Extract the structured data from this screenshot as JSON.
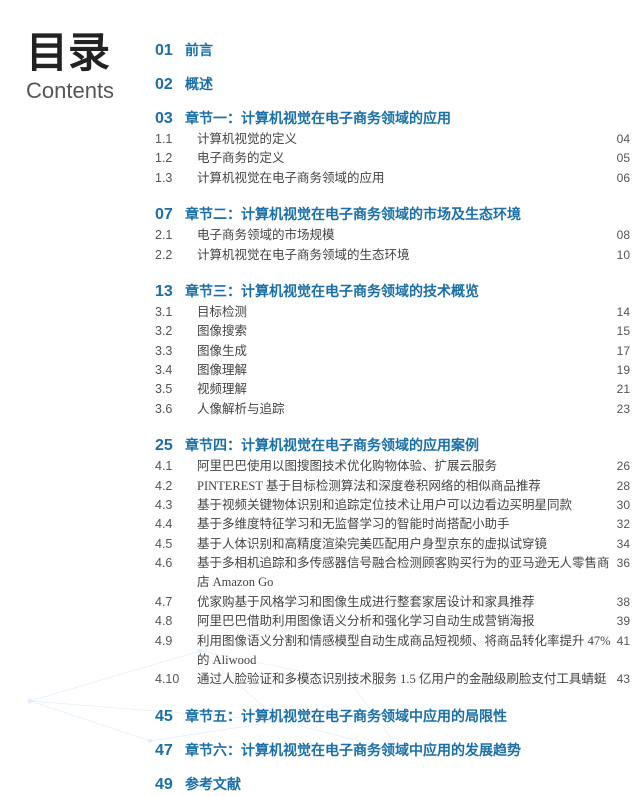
{
  "title": {
    "zh": "目录",
    "en": "Contents"
  },
  "sections": [
    {
      "num": "01",
      "label": "前言",
      "page": null,
      "items": []
    },
    {
      "num": "02",
      "label": "概述",
      "page": null,
      "items": []
    },
    {
      "num": "03",
      "label": "章节一：计算机视觉在电子商务领域的应用",
      "page": null,
      "items": [
        {
          "sub": "1.1",
          "label": "计算机视觉的定义",
          "page": "04"
        },
        {
          "sub": "1.2",
          "label": "电子商务的定义",
          "page": "05"
        },
        {
          "sub": "1.3",
          "label": "计算机视觉在电子商务领域的应用",
          "page": "06"
        }
      ]
    },
    {
      "num": "07",
      "label": "章节二：计算机视觉在电子商务领域的市场及生态环境",
      "page": null,
      "items": [
        {
          "sub": "2.1",
          "label": "电子商务领域的市场规模",
          "page": "08"
        },
        {
          "sub": "2.2",
          "label": "计算机视觉在电子商务领域的生态环境",
          "page": "10"
        }
      ]
    },
    {
      "num": "13",
      "label": "章节三：计算机视觉在电子商务领域的技术概览",
      "page": null,
      "items": [
        {
          "sub": "3.1",
          "label": "目标检测",
          "page": "14"
        },
        {
          "sub": "3.2",
          "label": "图像搜索",
          "page": "15"
        },
        {
          "sub": "3.3",
          "label": "图像生成",
          "page": "17"
        },
        {
          "sub": "3.4",
          "label": "图像理解",
          "page": "19"
        },
        {
          "sub": "3.5",
          "label": "视频理解",
          "page": "21"
        },
        {
          "sub": "3.6",
          "label": "人像解析与追踪",
          "page": "23"
        }
      ]
    },
    {
      "num": "25",
      "label": "章节四：计算机视觉在电子商务领域的应用案例",
      "page": null,
      "items": [
        {
          "sub": "4.1",
          "label": "阿里巴巴使用以图搜图技术优化购物体验、扩展云服务",
          "page": "26"
        },
        {
          "sub": "4.2",
          "label": "PINTEREST 基于目标检测算法和深度卷积网络的相似商品推荐",
          "page": "28"
        },
        {
          "sub": "4.3",
          "label": "基于视频关键物体识别和追踪定位技术让用户可以边看边买明星同款",
          "page": "30"
        },
        {
          "sub": "4.4",
          "label": "基于多维度特征学习和无监督学习的智能时尚搭配小助手",
          "page": "32"
        },
        {
          "sub": "4.5",
          "label": "基于人体识别和高精度渲染完美匹配用户身型京东的虚拟试穿镜",
          "page": "34"
        },
        {
          "sub": "4.6",
          "label": "基于多相机追踪和多传感器信号融合检测顾客购买行为的亚马逊无人零售商店 Amazon Go",
          "page": "36"
        },
        {
          "sub": "4.7",
          "label": "优家购基于风格学习和图像生成进行整套家居设计和家具推荐",
          "page": "38"
        },
        {
          "sub": "4.8",
          "label": "阿里巴巴借助利用图像语义分析和强化学习自动生成营销海报",
          "page": "39"
        },
        {
          "sub": "4.9",
          "label": "利用图像语义分割和情感模型自动生成商品短视频、将商品转化率提升 47% 的 Aliwood",
          "page": "41"
        },
        {
          "sub": "4.10",
          "label": "通过人脸验证和多模态识别技术服务 1.5 亿用户的金融级刷脸支付工具蜻蜓",
          "page": "43"
        }
      ]
    },
    {
      "num": "45",
      "label": "章节五：计算机视觉在电子商务领域中应用的局限性",
      "page": null,
      "items": []
    },
    {
      "num": "47",
      "label": "章节六：计算机视觉在电子商务领域中应用的发展趋势",
      "page": null,
      "items": []
    },
    {
      "num": "49",
      "label": "参考文献",
      "page": null,
      "items": []
    }
  ]
}
